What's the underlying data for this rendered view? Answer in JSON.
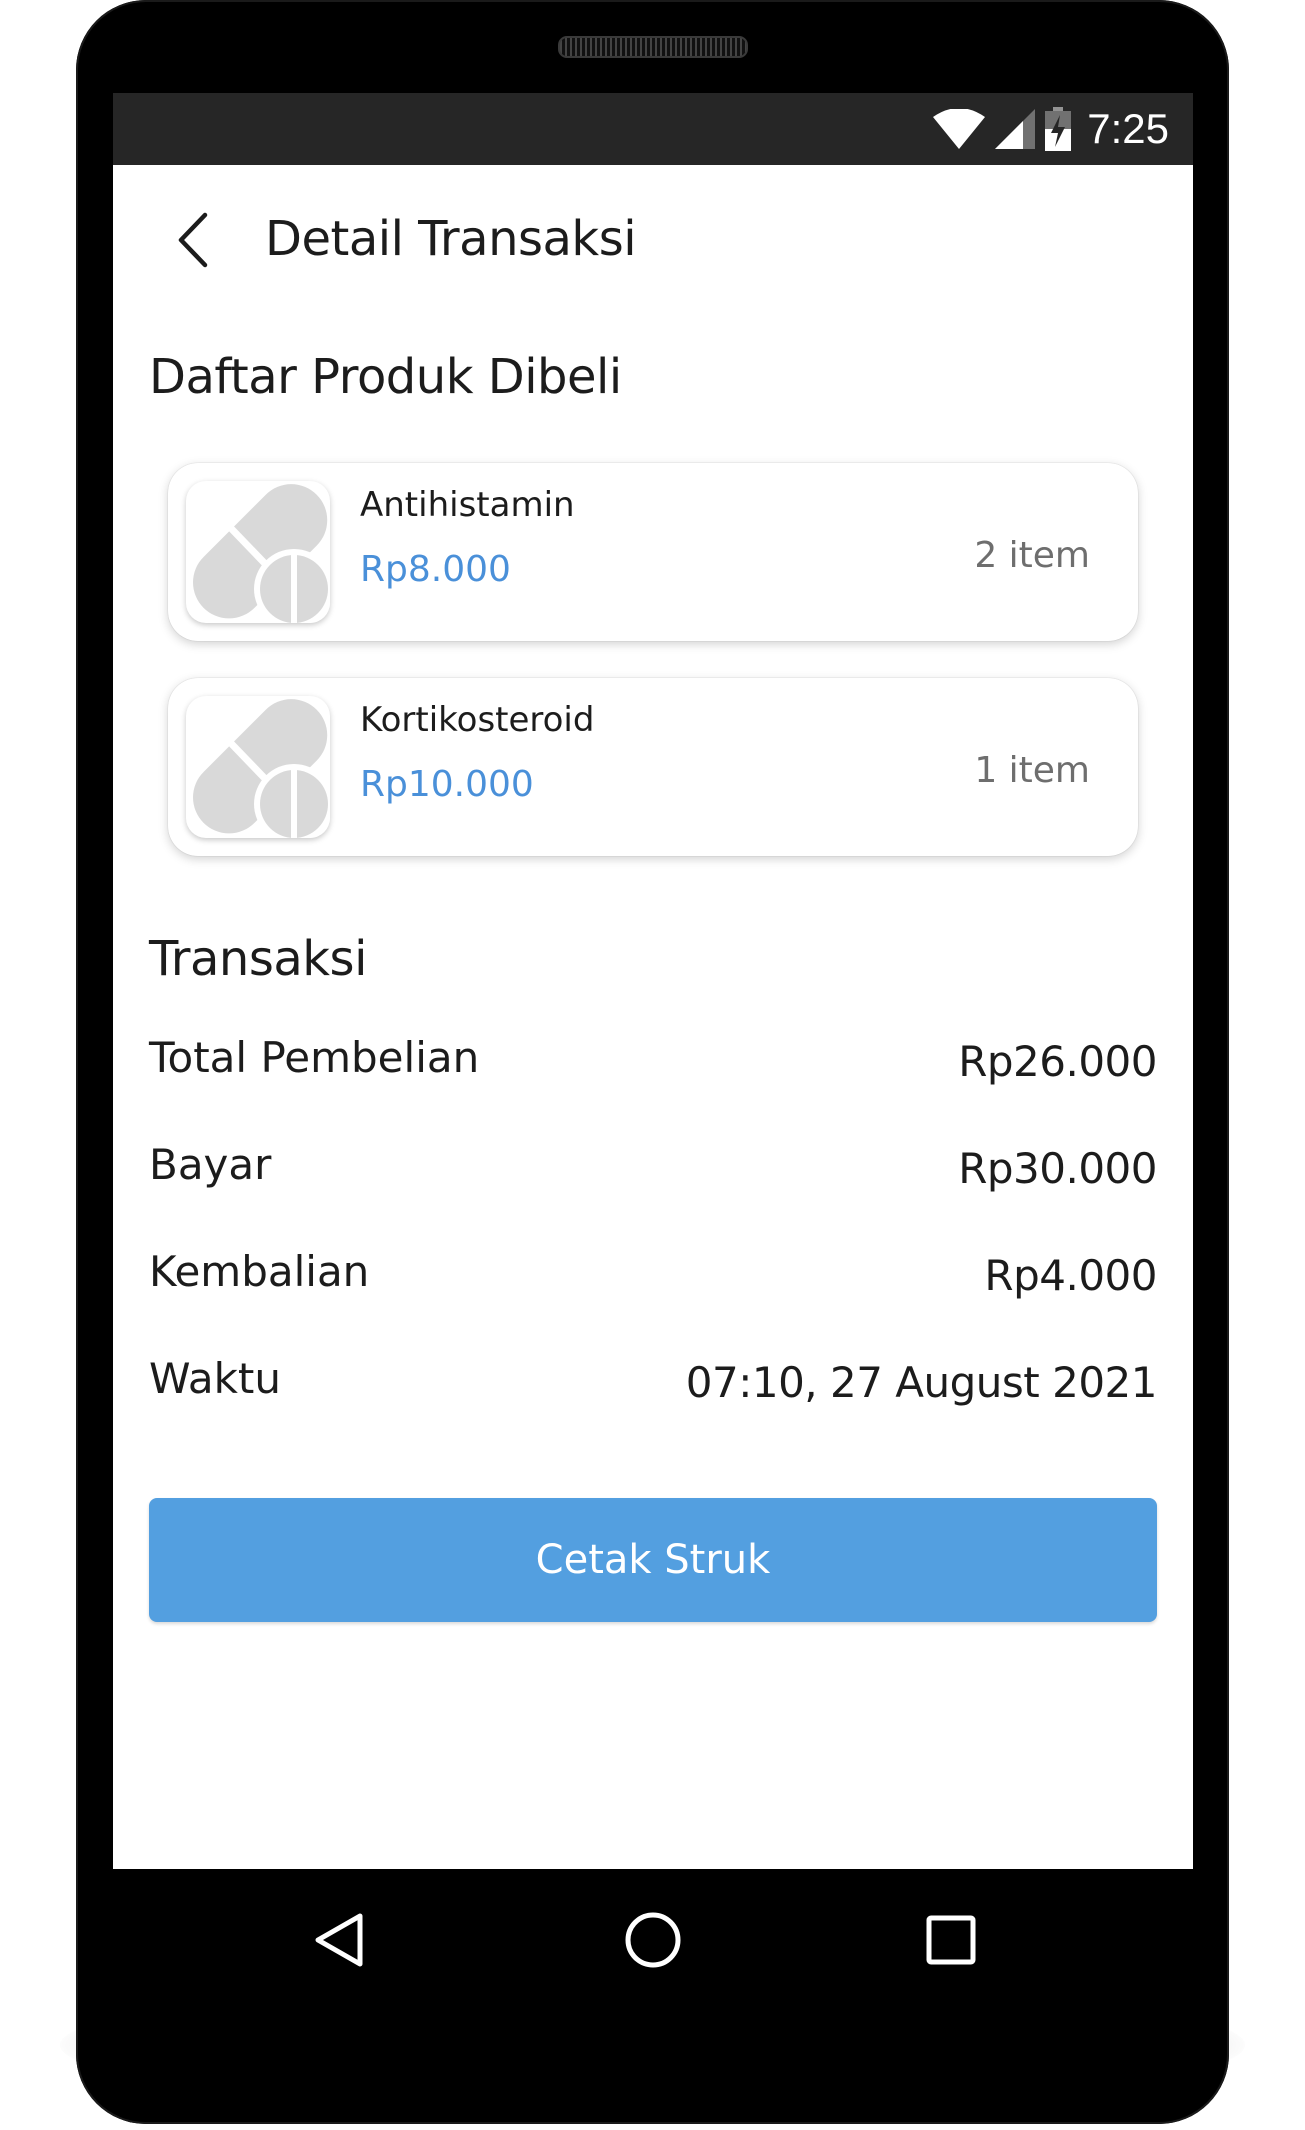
{
  "status_bar": {
    "time": "7:25"
  },
  "app_bar": {
    "title": "Detail Transaksi"
  },
  "products_section": {
    "title": "Daftar Produk Dibeli"
  },
  "products": [
    {
      "name": "Antihistamin",
      "price": "Rp8.000",
      "quantity": "2 item"
    },
    {
      "name": "Kortikosteroid",
      "price": "Rp10.000",
      "quantity": "1 item"
    }
  ],
  "transaction_section": {
    "title": "Transaksi"
  },
  "transaction": [
    {
      "label": "Total Pembelian",
      "value": "Rp26.000"
    },
    {
      "label": "Bayar",
      "value": "Rp30.000"
    },
    {
      "label": "Kembalian",
      "value": "Rp4.000"
    },
    {
      "label": "Waktu",
      "value": "07:10, 27 August 2021"
    }
  ],
  "print_button": {
    "label": "Cetak Struk"
  },
  "colors": {
    "accent": "#539fe0",
    "price": "#4a90d9",
    "status_bar": "#262626"
  },
  "icons": {
    "back": "back-arrow-icon",
    "wifi": "wifi-icon",
    "signal": "signal-icon",
    "battery": "battery-charging-icon",
    "product": "pill-icon",
    "nav_back": "nav-back-icon",
    "nav_home": "nav-home-icon",
    "nav_recent": "nav-recent-icon"
  }
}
